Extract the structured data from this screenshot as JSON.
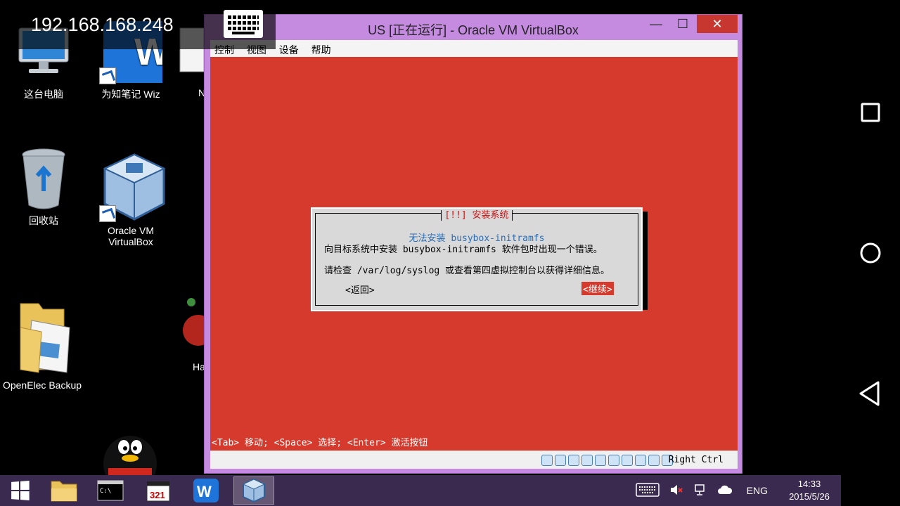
{
  "remote": {
    "ip": "192.168.168.248"
  },
  "desktop": {
    "icons": [
      {
        "label": "这台电脑"
      },
      {
        "label": "为知笔记 Wiz"
      },
      {
        "label": "N"
      },
      {
        "label": "回收站"
      },
      {
        "label": "Oracle VM VirtualBox"
      },
      {
        "label": "OpenElec Backup"
      },
      {
        "label": "Ha"
      }
    ]
  },
  "vbox": {
    "title": "US [正在运行] - Oracle VM VirtualBox",
    "minimize": "—",
    "maximize": "☐",
    "close": "✕",
    "menu": [
      "控制",
      "视图",
      "设备",
      "帮助"
    ],
    "host_key": "Right Ctrl"
  },
  "dialog": {
    "title": "[!!] 安装系统",
    "heading": "无法安装 busybox-initramfs",
    "line1": "向目标系统中安装 busybox-initramfs 软件包时出现一个错误。",
    "line2": "请检查 /var/log/syslog 或查看第四虚拟控制台以获得详细信息。",
    "back": "<返回>",
    "continue": "<继续>"
  },
  "vm_hint": "<Tab> 移动; <Space> 选择; <Enter> 激活按钮",
  "taskbar": {
    "tray": {
      "lang": "ENG",
      "time": "14:33",
      "date": "2015/5/26"
    }
  },
  "colors": {
    "vm_bg": "#d63a2c",
    "window_frame": "#c58be0",
    "taskbar": "#3b2a4f",
    "dialog_heading": "#2a6db5"
  }
}
